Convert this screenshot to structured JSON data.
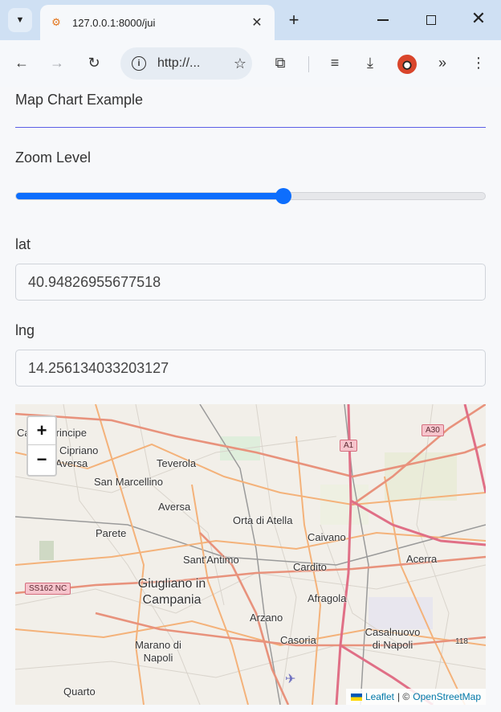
{
  "browser": {
    "tab_title": "127.0.0.1:8000/jui",
    "url": "http://...",
    "icons": {
      "tab_dropdown": "chevron-down-icon",
      "favicon": "python-favicon-icon",
      "close_tab": "close-icon",
      "new_tab": "plus-icon",
      "back": "arrow-left-icon",
      "forward": "arrow-right-icon",
      "reload": "reload-icon",
      "site_info": "info-icon",
      "bookmark": "star-icon",
      "extensions": "puzzle-icon",
      "reading_list": "media-list-icon",
      "downloads": "download-icon",
      "profile": "avatar-icon",
      "more_tools": "double-chevron-icon",
      "menu": "kebab-menu-icon"
    }
  },
  "app": {
    "heading": "Map Chart Example",
    "zoom": {
      "label": "Zoom Level",
      "value_fraction": 0.57
    },
    "lat": {
      "label": "lat",
      "value": "40.94826955677518"
    },
    "lng": {
      "label": "lng",
      "value": "14.256134033203127"
    }
  },
  "map": {
    "zoom_in": "+",
    "zoom_out": "−",
    "places": [
      "Principe",
      "Cipriano",
      "Aversa",
      "Teverola",
      "San Marcellino",
      "Aversa",
      "Orta di Atella",
      "Parete",
      "Caivano",
      "Sant'Antimo",
      "Cardito",
      "Acerra",
      "Giugliano in Campania",
      "Afragola",
      "Arzano",
      "Casoria",
      "Casalnuovo di Napoli",
      "Marano di Napoli",
      "Quarto",
      "Ca"
    ],
    "shields": [
      "A1",
      "A30",
      "SS162 NC",
      "118"
    ],
    "attribution": {
      "leaflet": "Leaflet",
      "separator": "| ©",
      "osm": "OpenStreetMap"
    }
  },
  "colors": {
    "accent": "#0d6efd",
    "heading_line": "#5b5ee6",
    "tabbar": "#cfe0f3"
  }
}
